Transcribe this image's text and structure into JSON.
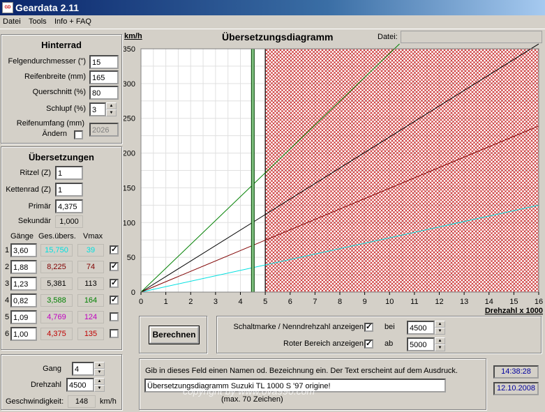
{
  "app": {
    "title": "Geardata 2.11",
    "icon": "geardata-app-icon"
  },
  "menu": [
    "Datei",
    "Tools",
    "Info + FAQ"
  ],
  "hinterrad": {
    "title": "Hinterrad",
    "felgen_label": "Felgendurchmesser (\")",
    "felgen_value": "15",
    "breite_label": "Reifenbreite (mm)",
    "breite_value": "165",
    "querschnitt_label": "Querschnitt (%)",
    "querschnitt_value": "80",
    "schlupf_label": "Schlupf (%)",
    "schlupf_value": "3",
    "umfang_label": "Reifenumfang (mm)",
    "aendern_label": "Ändern",
    "umfang_value": "2026"
  },
  "uebersetzungen": {
    "title": "Übersetzungen",
    "ritzel_label": "Ritzel (Z)",
    "ritzel_value": "1",
    "kettenrad_label": "Kettenrad (Z)",
    "kettenrad_value": "1",
    "primaer_label": "Primär",
    "primaer_value": "4,375",
    "sekundaer_label": "Sekundär",
    "sekundaer_value": "1,000",
    "col_gaenge": "Gänge",
    "col_gesuebers": "Ges.übers.",
    "col_vmax": "Vmax",
    "gears": [
      {
        "num": "1",
        "ratio": "3,60",
        "total": "15,750",
        "vmax": "39",
        "checked": true,
        "color": "#00e0e0"
      },
      {
        "num": "2",
        "ratio": "1,88",
        "total": "8,225",
        "vmax": "74",
        "checked": true,
        "color": "#800000"
      },
      {
        "num": "3",
        "ratio": "1,23",
        "total": "5,381",
        "vmax": "113",
        "checked": true,
        "color": "#000000"
      },
      {
        "num": "4",
        "ratio": "0,82",
        "total": "3,588",
        "vmax": "164",
        "checked": true,
        "color": "#008000"
      },
      {
        "num": "5",
        "ratio": "1,09",
        "total": "4,769",
        "vmax": "124",
        "checked": false,
        "color": "#c000c0"
      },
      {
        "num": "6",
        "ratio": "1,00",
        "total": "4,375",
        "vmax": "135",
        "checked": false,
        "color": "#c00000"
      }
    ]
  },
  "bottom_left": {
    "gang_label": "Gang",
    "gang_value": "4",
    "drehzahl_label": "Drehzahl",
    "drehzahl_value": "4500",
    "geschw_label": "Geschwindigkeit:",
    "geschw_value": "148",
    "geschw_unit": "km/h"
  },
  "chart_header": {
    "unit_label": "km/h",
    "title": "Übersetzungsdiagramm",
    "datei_label": "Datei:",
    "datei_value": ""
  },
  "chart_data": {
    "type": "line",
    "xlabel": "Drehzahl x 1000",
    "ylabel": "km/h",
    "xlim": [
      0,
      16
    ],
    "ylim": [
      0,
      350
    ],
    "xticks": [
      0,
      1,
      2,
      3,
      4,
      5,
      6,
      7,
      8,
      9,
      10,
      11,
      12,
      13,
      14,
      15,
      16
    ],
    "yticks": [
      0,
      50,
      100,
      150,
      200,
      250,
      300,
      350
    ],
    "grid": true,
    "red_zone_start": 5,
    "shift_marker": 4.5,
    "series": [
      {
        "color": "#00e0e0",
        "x": [
          0,
          16
        ],
        "y": [
          0,
          125
        ]
      },
      {
        "color": "#800000",
        "x": [
          0,
          16
        ],
        "y": [
          0,
          239
        ]
      },
      {
        "color": "#000000",
        "x": [
          0,
          16
        ],
        "y": [
          0,
          357
        ]
      },
      {
        "color": "#008000",
        "x": [
          0,
          10.4
        ],
        "y": [
          0,
          357
        ]
      }
    ]
  },
  "controls": {
    "berechnen_label": "Berechnen",
    "schaltmarke_label": "Schaltmarke / Nenndrehzahl anzeigen",
    "schaltmarke_checked": true,
    "bei_label": "bei",
    "bei_value": "4500",
    "roter_label": "Roter Bereich anzeigen",
    "roter_checked": true,
    "ab_label": "ab",
    "ab_value": "5000"
  },
  "footer": {
    "hint": "Gib in dieses Feld einen Namen od. Bezeichnung ein. Der Text erscheint auf dem Ausdruck.",
    "name_value": "Übersetzungsdiagramm Suzuki TL 1000 S '97 origine!",
    "max_label": "(max. 70 Zeichen)",
    "time": "14:38:28",
    "date": "12.10.2008",
    "watermark": "copyright by www.ova990.com"
  }
}
